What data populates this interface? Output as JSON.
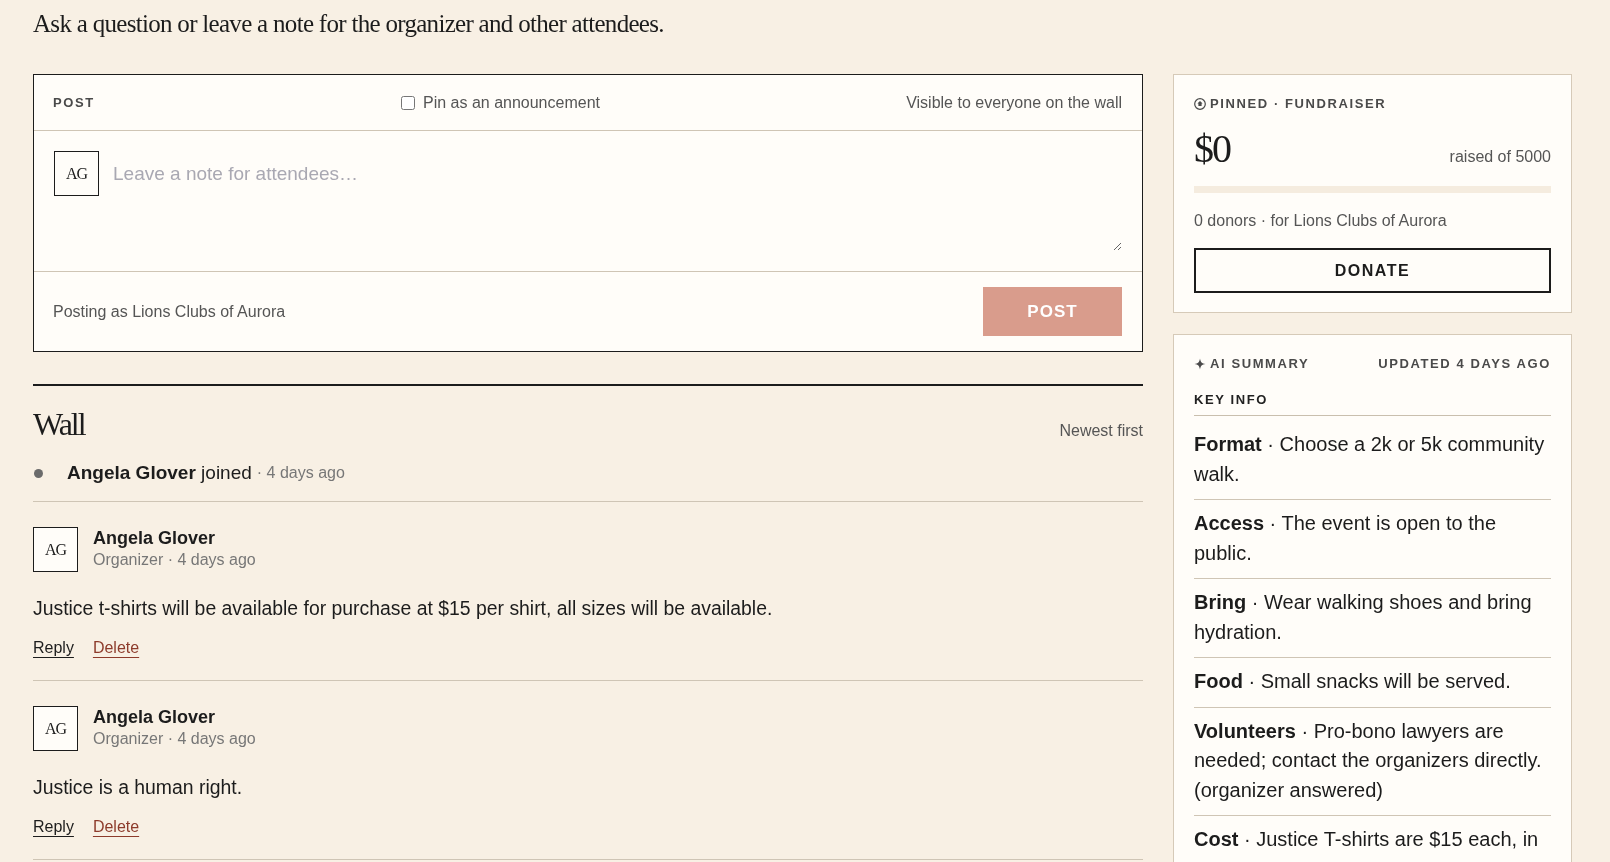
{
  "intro": "Ask a question or leave a note for the organizer and other attendees.",
  "composer": {
    "label": "POST",
    "pin": {
      "label": "Pin as an announcement",
      "checked": false
    },
    "visibility": "Visible to everyone on the wall",
    "avatar": "AG",
    "placeholder": "Leave a note for attendees…",
    "posting_as": "Posting as Lions Clubs of Aurora",
    "submit": {
      "label": "POST",
      "disabled": true
    }
  },
  "wall": {
    "title": "Wall",
    "sort": "Newest first",
    "feed": [
      {
        "kind": "event",
        "text": "**Angela Glover** joined",
        "time": "· 4 days ago"
      },
      {
        "kind": "post",
        "avatar": "AG",
        "author": "Angela Glover",
        "meta": "Organizer · 4 days ago",
        "body": "Justice t-shirts will be available for purchase at $15 per shirt, all sizes will be available.",
        "actions": [
          {
            "kind": "reply",
            "label": "Reply"
          },
          {
            "kind": "delete",
            "label": "Delete"
          }
        ]
      },
      {
        "kind": "post",
        "avatar": "AG",
        "author": "Angela Glover",
        "meta": "Organizer · 4 days ago",
        "body": "Justice is a human right.",
        "actions": [
          {
            "kind": "reply",
            "label": "Reply"
          },
          {
            "kind": "delete",
            "label": "Delete"
          }
        ]
      }
    ]
  },
  "fundraiser": {
    "tag": "PINNED · FUNDRAISER",
    "amount": "$0",
    "goal": "raised of 5000",
    "level": 0,
    "donors": "0 donors · for Lions Clubs of Aurora",
    "button": "DONATE"
  },
  "summary": {
    "title": "AI SUMMARY",
    "updated": "UPDATED 4 DAYS AGO",
    "section": "KEY INFO",
    "items": [
      "**Format** · Choose a 2k or 5k community walk.",
      "**Access** · The event is open to the public.",
      "**Bring** · Wear walking shoes and bring hydration.",
      "**Food** · Small snacks will be served.",
      "**Volunteers** · Pro-bono lawyers are needed; contact the organizers directly. (organizer answered)",
      "**Cost** · Justice T-shirts are $15 each, in"
    ]
  }
}
